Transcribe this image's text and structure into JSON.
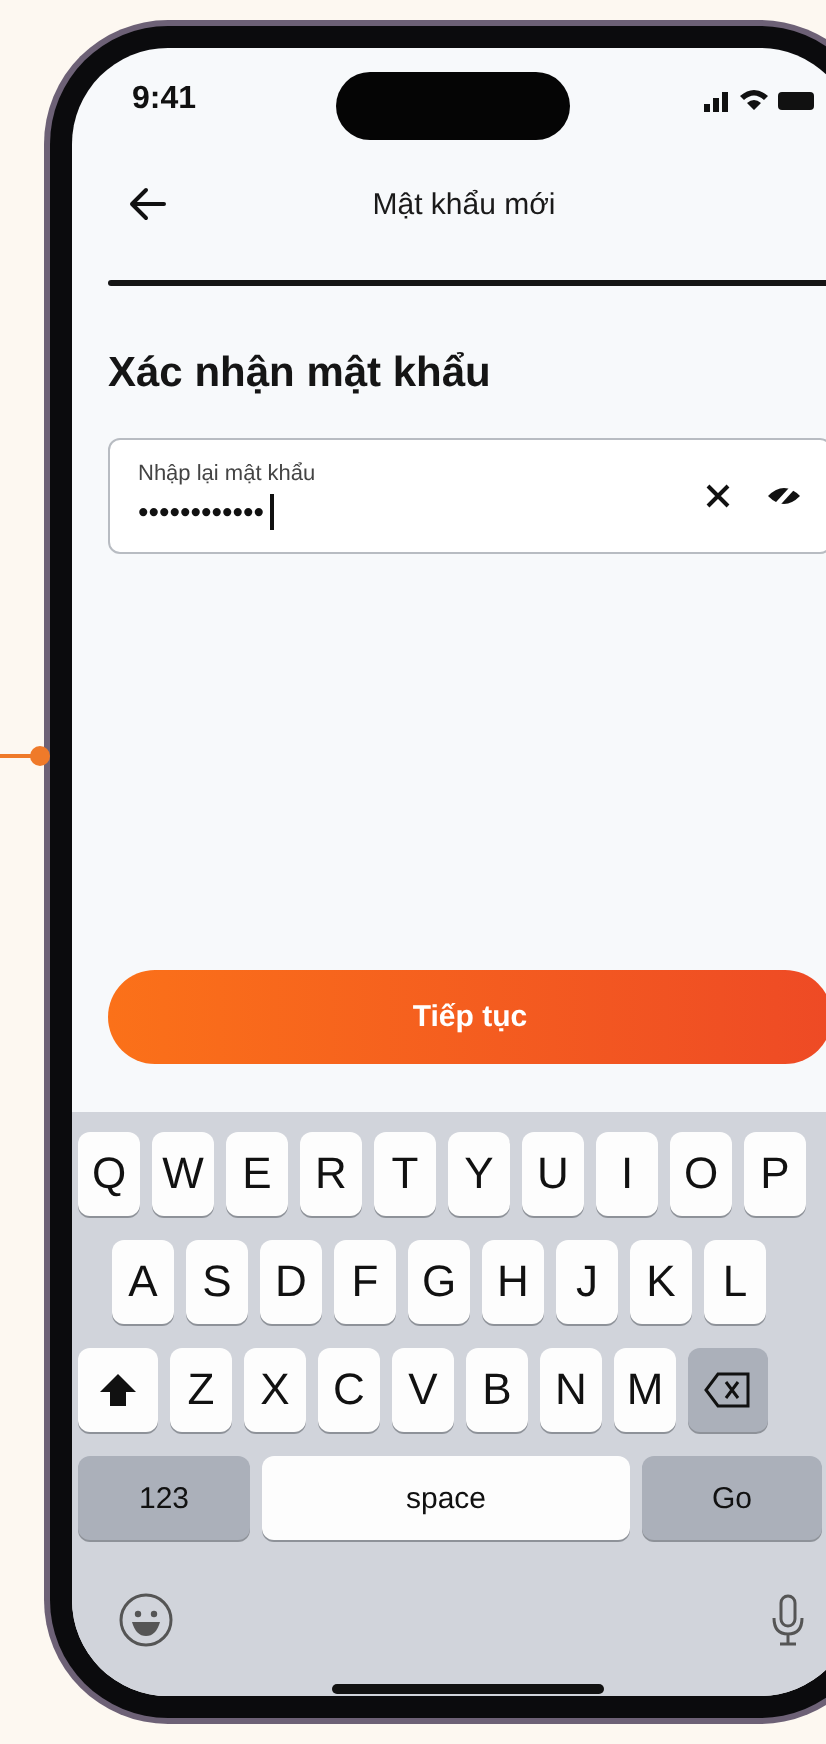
{
  "status_bar": {
    "time": "9:41"
  },
  "nav": {
    "title": "Mật khẩu mới"
  },
  "heading": "Xác nhận mật khẩu",
  "password_field": {
    "label": "Nhập lại mật khẩu",
    "value": "••••••••••••"
  },
  "primary_button": {
    "label": "Tiếp tục"
  },
  "keyboard": {
    "rows": [
      [
        {
          "kind": "letter",
          "label": "Q"
        },
        {
          "kind": "letter",
          "label": "W"
        },
        {
          "kind": "letter",
          "label": "E"
        },
        {
          "kind": "letter",
          "label": "R"
        },
        {
          "kind": "letter",
          "label": "T"
        },
        {
          "kind": "letter",
          "label": "Y"
        },
        {
          "kind": "letter",
          "label": "U"
        },
        {
          "kind": "letter",
          "label": "I"
        },
        {
          "kind": "letter",
          "label": "O"
        },
        {
          "kind": "letter",
          "label": "P"
        }
      ],
      [
        {
          "kind": "letter",
          "label": "A"
        },
        {
          "kind": "letter",
          "label": "S"
        },
        {
          "kind": "letter",
          "label": "D"
        },
        {
          "kind": "letter",
          "label": "F"
        },
        {
          "kind": "letter",
          "label": "G"
        },
        {
          "kind": "letter",
          "label": "H"
        },
        {
          "kind": "letter",
          "label": "J"
        },
        {
          "kind": "letter",
          "label": "K"
        },
        {
          "kind": "letter",
          "label": "L"
        }
      ],
      [
        {
          "kind": "shift"
        },
        {
          "kind": "letter",
          "label": "Z"
        },
        {
          "kind": "letter",
          "label": "X"
        },
        {
          "kind": "letter",
          "label": "C"
        },
        {
          "kind": "letter",
          "label": "V"
        },
        {
          "kind": "letter",
          "label": "B"
        },
        {
          "kind": "letter",
          "label": "N"
        },
        {
          "kind": "letter",
          "label": "M"
        },
        {
          "kind": "delete"
        }
      ]
    ],
    "bottom_keys": [
      {
        "kind": "mode",
        "label": "123"
      },
      {
        "kind": "space",
        "label": "space"
      },
      {
        "kind": "go",
        "label": "Go"
      }
    ]
  }
}
